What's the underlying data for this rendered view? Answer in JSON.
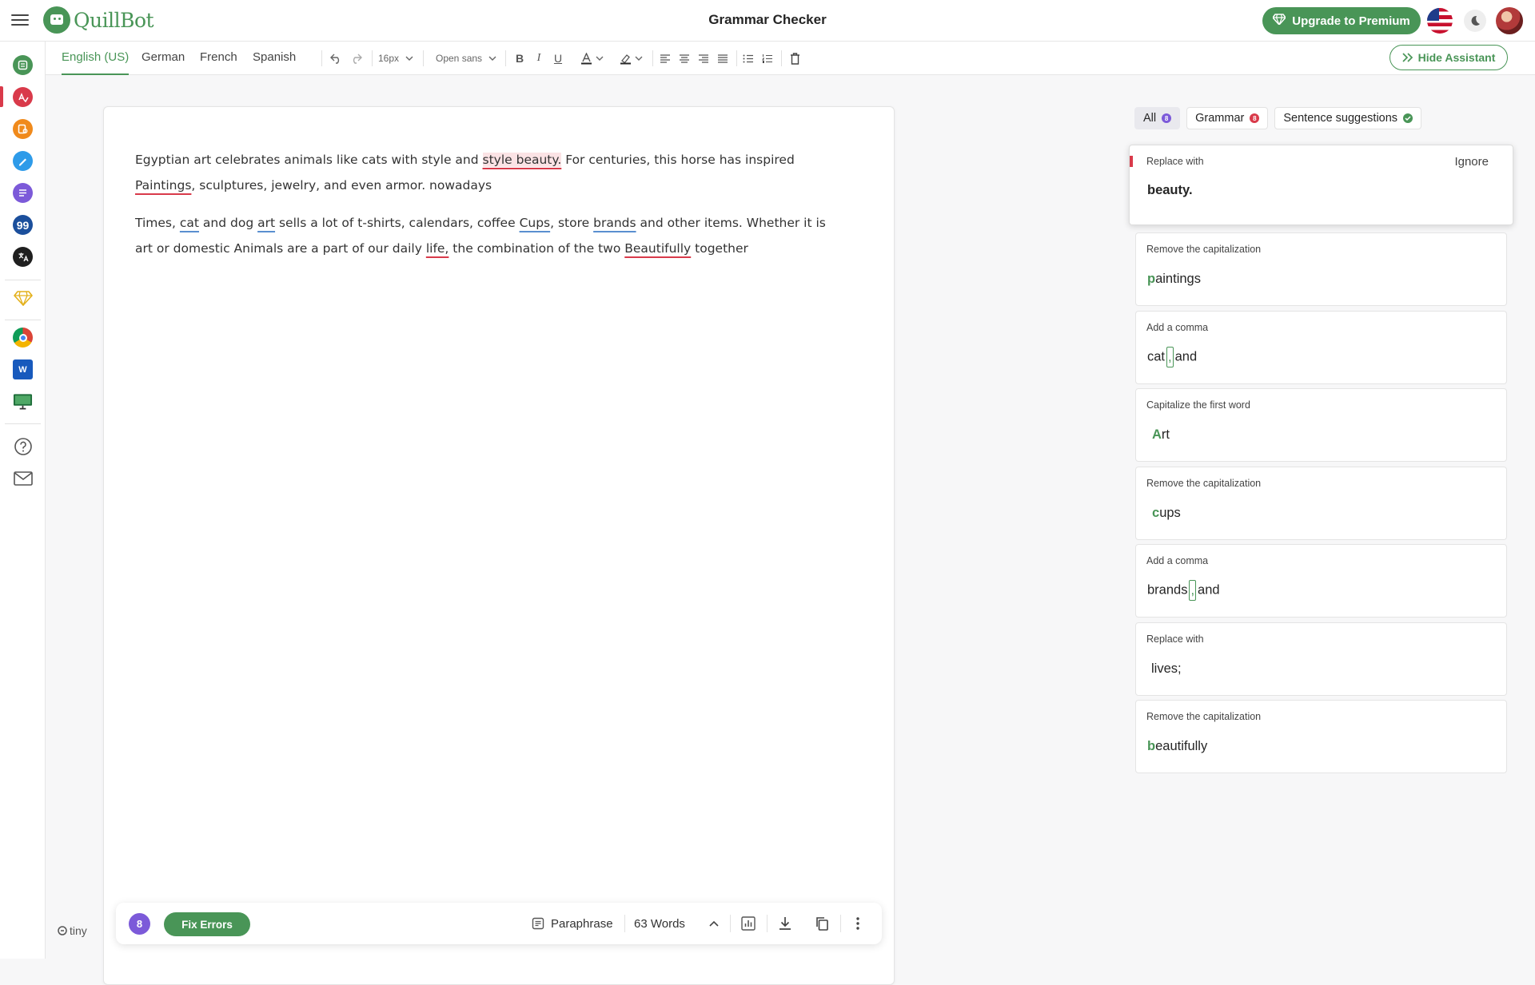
{
  "app": {
    "logo_text": "QuillBot",
    "page_title": "Grammar Checker",
    "upgrade_label": "Upgrade to Premium",
    "brand_color": "#499557",
    "error_color": "#d93a4a"
  },
  "sidebar": {
    "items": [
      {
        "name": "paraphraser",
        "color": "#499557"
      },
      {
        "name": "grammar-checker",
        "color": "#d93a4a"
      },
      {
        "name": "ai-detector",
        "color": "#f08a1c"
      },
      {
        "name": "ai-humanizer",
        "color": "#2e9be9"
      },
      {
        "name": "summarizer",
        "color": "#7c5ad9"
      },
      {
        "name": "citation-generator",
        "color": "#1b4f9c"
      },
      {
        "name": "translator",
        "color": "#1f1f1f"
      }
    ],
    "footer_label": "tiny"
  },
  "toolbar": {
    "languages": [
      "English (US)",
      "German",
      "French",
      "Spanish"
    ],
    "active_language": "English (US)",
    "font_size": "16px",
    "font_family": "Open sans",
    "hide_assistant_label": "Hide Assistant"
  },
  "editor": {
    "p1": {
      "t1": "Egyptian art celebrates animals like cats with style and ",
      "e1": "style beauty.",
      "t2": " For centuries, this horse has inspired ",
      "e2": "Paintings",
      "t3": ", sculptures, jewelry, and even armor. nowadays"
    },
    "p2": {
      "t1": "Times, ",
      "e1": "cat",
      "t2": " and dog ",
      "e2": "art",
      "t3": " sells a lot of t-shirts, calendars, coffee ",
      "e3": "Cups",
      "t4": ", store ",
      "e4": "brands",
      "t5": " and other items. Whether it is art or domestic Animals are a part of our daily ",
      "e5": "life,",
      "t6": " the combination of the two ",
      "e6": "Beautifully",
      "t7": " together"
    }
  },
  "bottom_bar": {
    "error_count": "8",
    "fix_label": "Fix Errors",
    "paraphrase_label": "Paraphrase",
    "word_count": "63 Words"
  },
  "assistant": {
    "tabs": [
      {
        "label": "All",
        "count": "8"
      },
      {
        "label": "Grammar",
        "count": "8"
      },
      {
        "label": "Sentence suggestions"
      }
    ],
    "ignore_label": "Ignore",
    "suggestions": [
      {
        "label": "Replace with",
        "value": "beauty."
      },
      {
        "label": "Remove the capitalization",
        "first": "p",
        "rest": "aintings"
      },
      {
        "label": "Add a comma",
        "before": "cat",
        "insert": ",",
        "after": "and"
      },
      {
        "label": "Capitalize the first word",
        "first": "A",
        "rest": "rt"
      },
      {
        "label": "Remove the capitalization",
        "first": "c",
        "rest": "ups"
      },
      {
        "label": "Add a comma",
        "before": "brands",
        "insert": ",",
        "after": "and"
      },
      {
        "label": "Replace with",
        "value": "lives;"
      },
      {
        "label": "Remove the capitalization",
        "first": "b",
        "rest": "eautifully"
      }
    ]
  }
}
